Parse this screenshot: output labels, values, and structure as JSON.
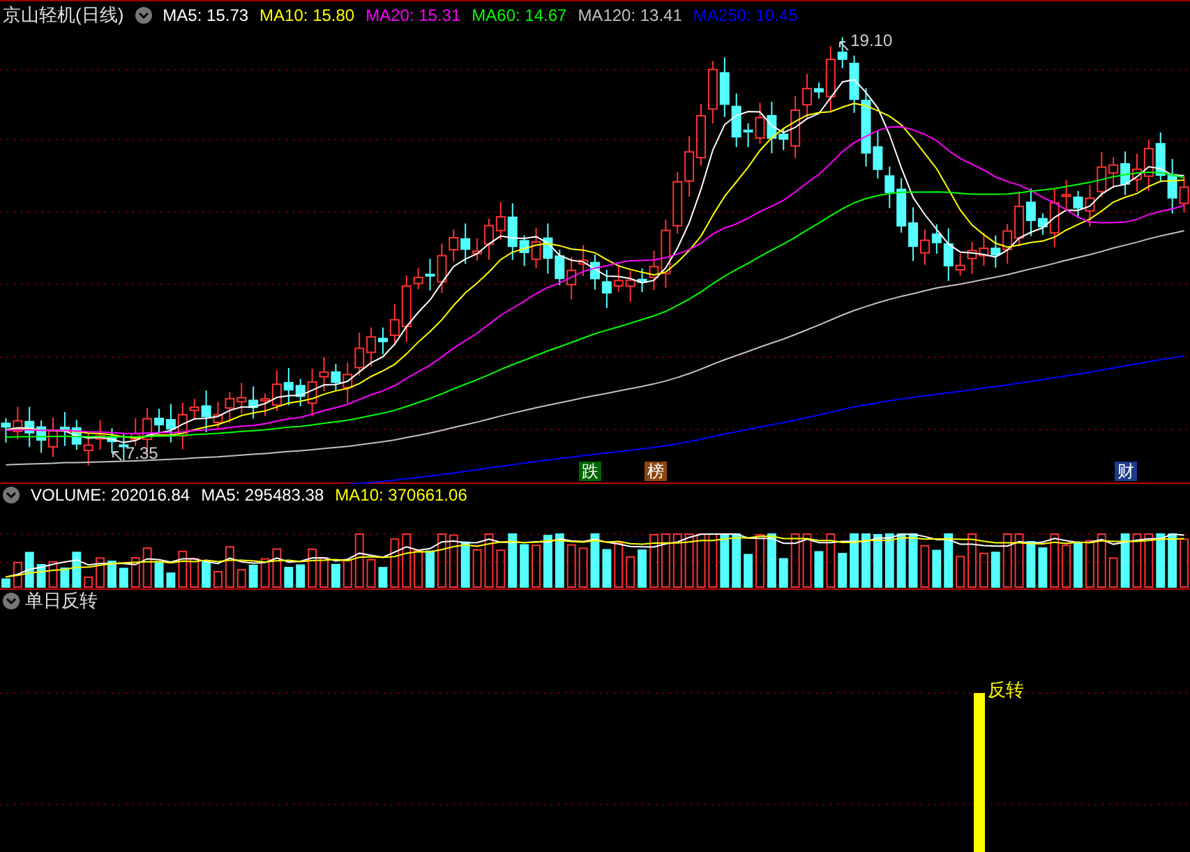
{
  "title": "京山轻机(日线)",
  "ma_legend": [
    {
      "label": "MA5: 15.73",
      "color": "#ffffff"
    },
    {
      "label": "MA10: 15.80",
      "color": "#ffff00"
    },
    {
      "label": "MA20: 15.31",
      "color": "#ff00ff"
    },
    {
      "label": "MA60: 14.67",
      "color": "#00ff00"
    },
    {
      "label": "MA120: 13.41",
      "color": "#c0c0c0"
    },
    {
      "label": "MA250: 10.45",
      "color": "#0000ff"
    }
  ],
  "price_labels": {
    "high": "19.10",
    "low": "7.35"
  },
  "event_badges": [
    {
      "text": "跌",
      "color": "#006400"
    },
    {
      "text": "榜",
      "color": "#8b4513"
    },
    {
      "text": "财",
      "color": "#1e3a8a"
    }
  ],
  "volume_legend": [
    {
      "label": "VOLUME: 202016.84",
      "color": "#ffffff"
    },
    {
      "label": "MA5: 295483.38",
      "color": "#ffffff"
    },
    {
      "label": "MA10: 370661.06",
      "color": "#ffff00"
    }
  ],
  "indicator": {
    "title": "单日反转",
    "signal_label": "反转"
  }
}
